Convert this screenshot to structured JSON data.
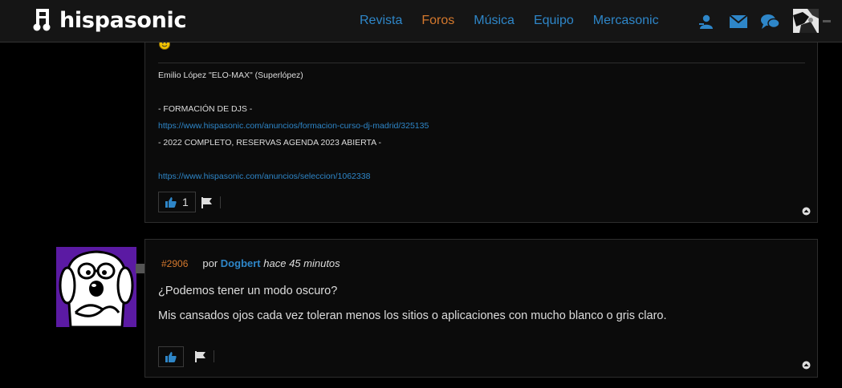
{
  "header": {
    "logo_text": "hispasonic",
    "nav": [
      {
        "label": "Revista",
        "active": false
      },
      {
        "label": "Foros",
        "active": true
      },
      {
        "label": "Música",
        "active": false
      },
      {
        "label": "Equipo",
        "active": false
      },
      {
        "label": "Mercasonic",
        "active": false
      }
    ],
    "icons": [
      "user-icon",
      "mail-icon",
      "chat-icon"
    ]
  },
  "post1": {
    "emoji_icon": "smiley-icon",
    "signature": {
      "name_line": "Emilio López \"ELO-MAX\" (Superlópez)",
      "line2": "- FORMACIÓN DE DJS -",
      "link1": "https://www.hispasonic.com/anuncios/formacion-curso-dj-madrid/325135",
      "line4": "- 2022 COMPLETO, RESERVAS AGENDA 2023 ABIERTA -",
      "link2": "https://www.hispasonic.com/anuncios/seleccion/1062338"
    },
    "likes": "1"
  },
  "post2": {
    "number": "#2906",
    "by": "por",
    "author": "Dogbert",
    "time": "hace 45 minutos",
    "paragraphs": [
      "¿Podemos tener un modo oscuro?",
      "Mis cansados ojos cada vez toleran menos los sitios o aplicaciones con mucho blanco o gris claro."
    ]
  },
  "colors": {
    "link": "#2e86c8",
    "active_nav": "#d4782d",
    "background": "#000000",
    "avatar_bg": "#5b1aa3"
  }
}
